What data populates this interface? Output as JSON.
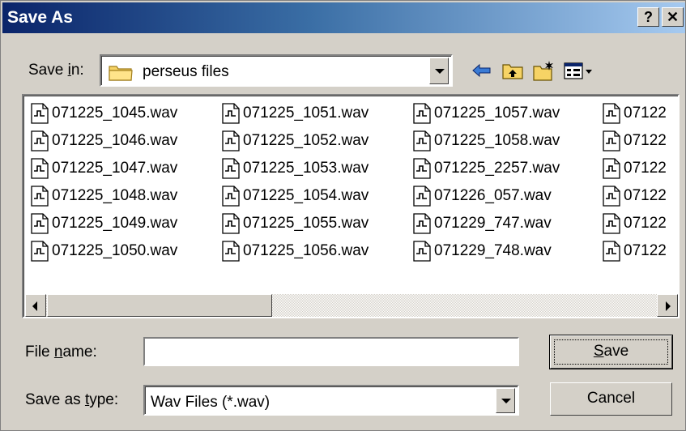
{
  "window": {
    "title": "Save As",
    "help_label": "?",
    "close_label": "✕"
  },
  "save_in": {
    "label_prefix": "Save ",
    "label_access": "i",
    "label_suffix": "n:",
    "value": "perseus files",
    "icon": "folder-icon"
  },
  "toolbar": {
    "icons": [
      "back-arrow-icon",
      "up-one-level-icon",
      "create-new-folder-icon",
      "view-menu-icon"
    ]
  },
  "files": {
    "columns": [
      [
        "071225_1045.wav",
        "071225_1046.wav",
        "071225_1047.wav",
        "071225_1048.wav",
        "071225_1049.wav",
        "071225_1050.wav"
      ],
      [
        "071225_1051.wav",
        "071225_1052.wav",
        "071225_1053.wav",
        "071225_1054.wav",
        "071225_1055.wav",
        "071225_1056.wav"
      ],
      [
        "071225_1057.wav",
        "071225_1058.wav",
        "071225_2257.wav",
        "071226_057.wav",
        "071229_747.wav",
        "071229_748.wav"
      ],
      [
        "07122",
        "07122",
        "07122",
        "07122",
        "07122",
        "07122"
      ]
    ]
  },
  "file_name": {
    "label_prefix": "File ",
    "label_access": "n",
    "label_suffix": "ame:",
    "value": "",
    "placeholder": ""
  },
  "save_as_type": {
    "label_prefix": "Save as ",
    "label_access": "t",
    "label_suffix": "ype:",
    "value": "Wav Files (*.wav)"
  },
  "buttons": {
    "save_access": "S",
    "save_rest": "ave",
    "cancel": "Cancel"
  },
  "colors": {
    "title_gradient_start": "#0a246a",
    "title_gradient_end": "#a6caf0",
    "face": "#d4d0c8"
  }
}
